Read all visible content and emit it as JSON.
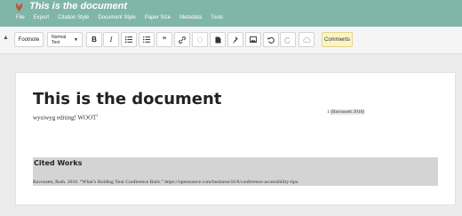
{
  "header": {
    "title": "This is the document",
    "menu": [
      "File",
      "Export",
      "Citation Style",
      "Document Style",
      "Paper Size",
      "Metadata",
      "Tools"
    ]
  },
  "toolbar": {
    "collapse_icon": "chevron-up-icon",
    "footnote_label": "Footnote",
    "style_select_value": "Normal Text",
    "bold_label": "B",
    "italic_label": "I",
    "comments_label": "Comments"
  },
  "document": {
    "heading": "This is the document",
    "body": "wysiwyg editing!  WOOT",
    "footnote_marker": "1",
    "footnote_number": "1",
    "footnote_citation": "(Bavousett 2016)",
    "cited_works_title": "Cited Works",
    "cited_entry": "Bavousett, Ruth. 2016. “What’s Holding Your Conference Back.” https://opensource.com/business/16/6/conference-accessibility-tips."
  },
  "colors": {
    "header_bg": "#7fb6a8",
    "comments_bg": "#fbf4c6",
    "cited_bg": "#d4d4d4"
  }
}
